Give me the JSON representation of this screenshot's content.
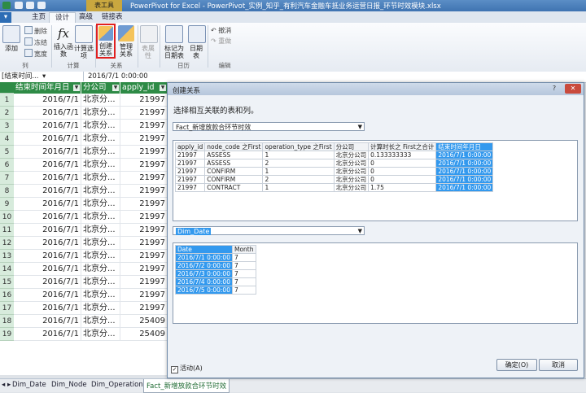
{
  "window": {
    "title": "PowerPivot for Excel - PowerPivot_实例_知乎_有利汽车金融车抵业务运营日报_环节时效模块.xlsx",
    "context_tab": "表工具"
  },
  "tabs": [
    {
      "label": "主页"
    },
    {
      "label": "设计"
    },
    {
      "label": "高级"
    },
    {
      "label": "链接表"
    }
  ],
  "ribbon": {
    "add_label": "添加",
    "delete_label": "删除",
    "freeze_label": "冻结",
    "width_label": "宽度",
    "group_columns": "列",
    "insert_function_label": "插入函数",
    "calc_options_label": "计算选项",
    "group_calc": "计算",
    "create_relationship_label": "创建关系",
    "manage_relationship_label": "管理关系",
    "group_relationships": "关系",
    "table_properties_label": "表属性",
    "mark_date_table_label": "标记为日期表",
    "date_table_label": "日期表",
    "group_calendar": "日历",
    "undo_label": "撤消",
    "redo_label": "重做",
    "group_edit": "编辑"
  },
  "formula_bar": {
    "name_box": "[结束时间...",
    "value": "2016/7/1 0:00:00"
  },
  "grid": {
    "headers": [
      "结束时间年月日",
      "分公司",
      "apply_id"
    ],
    "rows": [
      {
        "n": "1",
        "date": "2016/7/1",
        "company": "北京分...",
        "id": "21997"
      },
      {
        "n": "2",
        "date": "2016/7/1",
        "company": "北京分...",
        "id": "21997"
      },
      {
        "n": "3",
        "date": "2016/7/1",
        "company": "北京分...",
        "id": "21997"
      },
      {
        "n": "4",
        "date": "2016/7/1",
        "company": "北京分...",
        "id": "21997"
      },
      {
        "n": "5",
        "date": "2016/7/1",
        "company": "北京分...",
        "id": "21997"
      },
      {
        "n": "6",
        "date": "2016/7/1",
        "company": "北京分...",
        "id": "21997"
      },
      {
        "n": "7",
        "date": "2016/7/1",
        "company": "北京分...",
        "id": "21997"
      },
      {
        "n": "8",
        "date": "2016/7/1",
        "company": "北京分...",
        "id": "21997"
      },
      {
        "n": "9",
        "date": "2016/7/1",
        "company": "北京分...",
        "id": "21997"
      },
      {
        "n": "10",
        "date": "2016/7/1",
        "company": "北京分...",
        "id": "21997"
      },
      {
        "n": "11",
        "date": "2016/7/1",
        "company": "北京分...",
        "id": "21997"
      },
      {
        "n": "12",
        "date": "2016/7/1",
        "company": "北京分...",
        "id": "21997"
      },
      {
        "n": "13",
        "date": "2016/7/1",
        "company": "北京分...",
        "id": "21997"
      },
      {
        "n": "14",
        "date": "2016/7/1",
        "company": "北京分...",
        "id": "21997"
      },
      {
        "n": "15",
        "date": "2016/7/1",
        "company": "北京分...",
        "id": "21997"
      },
      {
        "n": "16",
        "date": "2016/7/1",
        "company": "北京分...",
        "id": "21997"
      },
      {
        "n": "17",
        "date": "2016/7/1",
        "company": "北京分...",
        "id": "21997"
      },
      {
        "n": "18",
        "date": "2016/7/1",
        "company": "北京分...",
        "id": "25409"
      },
      {
        "n": "19",
        "date": "2016/7/1",
        "company": "北京分...",
        "id": "25409"
      }
    ]
  },
  "sheet_tabs": [
    "Dim_Date",
    "Dim_Node",
    "Dim_Operation",
    "Fact_新增放款合环节时效"
  ],
  "dialog": {
    "title": "创建关系",
    "help": "?",
    "close": "✕",
    "instruction": "选择相互关联的表和列。",
    "table1": "Fact_新增放款合环节时效",
    "table1_headers": [
      "apply_id",
      "node_code 之First",
      "operation_type 之First",
      "分公司",
      "计算时长之 First之合计",
      "结束时间年月日"
    ],
    "table1_rows": [
      [
        "21997",
        "ASSESS",
        "1",
        "北京分公司",
        "0.133333333",
        "2016/7/1 0:00:00"
      ],
      [
        "21997",
        "ASSESS",
        "2",
        "北京分公司",
        "0",
        "2016/7/1 0:00:00"
      ],
      [
        "21997",
        "CONFIRM",
        "1",
        "北京分公司",
        "0",
        "2016/7/1 0:00:00"
      ],
      [
        "21997",
        "CONFIRM",
        "2",
        "北京分公司",
        "0",
        "2016/7/1 0:00:00"
      ],
      [
        "21997",
        "CONTRACT",
        "1",
        "北京分公司",
        "1.75",
        "2016/7/1 0:00:00"
      ]
    ],
    "table2": "Dim_Date",
    "table2_headers": [
      "Date",
      "Month"
    ],
    "table2_rows": [
      [
        "2016/7/1 0:00:00",
        "7"
      ],
      [
        "2016/7/2 0:00:00",
        "7"
      ],
      [
        "2016/7/3 0:00:00",
        "7"
      ],
      [
        "2016/7/4 0:00:00",
        "7"
      ],
      [
        "2016/7/5 0:00:00",
        "7"
      ]
    ],
    "active_label": "活动(A)",
    "ok_label": "确定(O)",
    "cancel_label": "取消"
  },
  "colors": {
    "header_green": "#2e8b46",
    "selection_blue": "#3399ee",
    "highlight_red": "#e02020"
  }
}
